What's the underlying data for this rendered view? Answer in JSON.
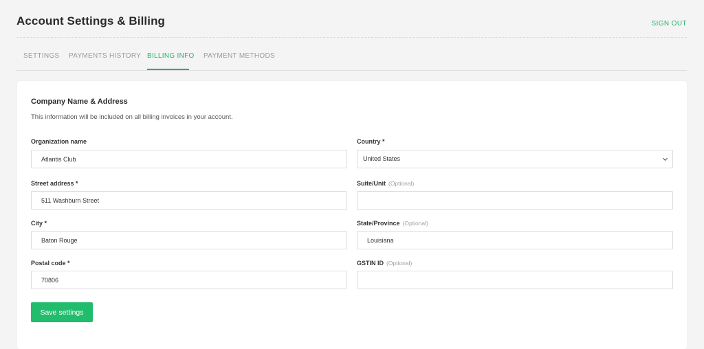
{
  "header": {
    "title": "Account Settings & Billing",
    "sign_out": "SIGN OUT"
  },
  "tabs": [
    {
      "label": "SETTINGS",
      "active": false
    },
    {
      "label": "PAYMENTS HISTORY",
      "active": false
    },
    {
      "label": "BILLING INFO",
      "active": true
    },
    {
      "label": "PAYMENT METHODS",
      "active": false
    }
  ],
  "section": {
    "title": "Company Name & Address",
    "description": "This information will be included on all billing invoices in your account."
  },
  "form": {
    "organization": {
      "label": "Organization name",
      "value": "Atlantis Club"
    },
    "country": {
      "label": "Country *",
      "value": "United States"
    },
    "street": {
      "label": "Street address *",
      "value": "511 Washburn Street"
    },
    "suite": {
      "label": "Suite/Unit",
      "optional": "(Optional)",
      "value": ""
    },
    "city": {
      "label": "City *",
      "value": "Baton Rouge"
    },
    "state": {
      "label": "State/Province",
      "optional": "(Optional)",
      "value": "Louisiana"
    },
    "postal": {
      "label": "Postal code *",
      "value": "70806"
    },
    "gstin": {
      "label": "GSTIN ID",
      "optional": "(Optional)",
      "value": ""
    }
  },
  "save_button": "Save settings",
  "colors": {
    "accent": "#27b06a",
    "button": "#21bc6c",
    "background": "#f4f4f5"
  },
  "icons": {
    "dropdown": "chevron-down-icon"
  }
}
